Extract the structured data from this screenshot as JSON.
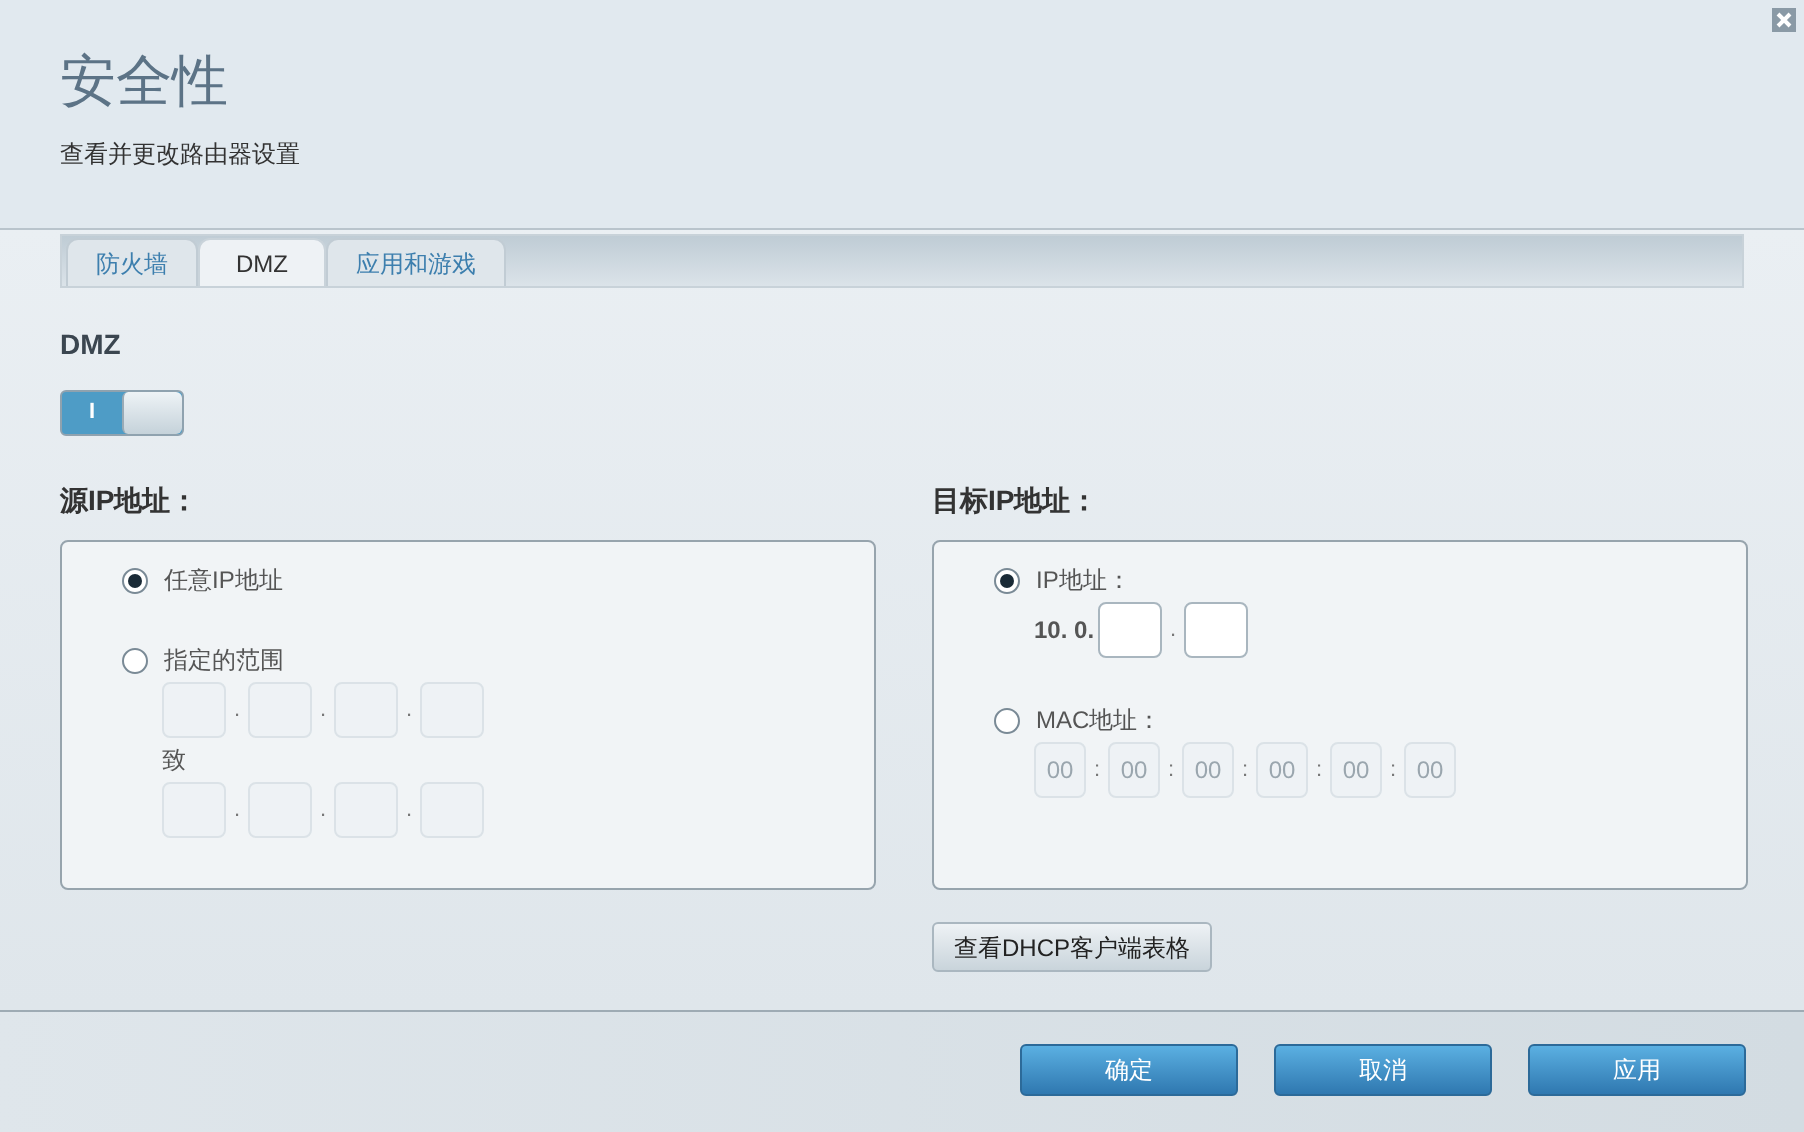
{
  "title": "安全性",
  "subtitle": "查看并更改路由器设置",
  "tabs": [
    {
      "label": "防火墙",
      "selected": false
    },
    {
      "label": "DMZ",
      "selected": true
    },
    {
      "label": "应用和游戏",
      "selected": false
    }
  ],
  "dmz": {
    "label": "DMZ",
    "on": true,
    "toggle_text": "I"
  },
  "source": {
    "heading": "源IP地址：",
    "options": [
      {
        "kind": "any",
        "label": "任意IP地址",
        "selected": true
      },
      {
        "kind": "range",
        "label": "指定的范围",
        "selected": false,
        "separator": ".",
        "range_word": "致"
      }
    ]
  },
  "destination": {
    "heading": "目标IP地址：",
    "options": [
      {
        "kind": "ip",
        "label": "IP地址：",
        "selected": true,
        "prefix": "10. 0.",
        "separator": "."
      },
      {
        "kind": "mac",
        "label": "MAC地址：",
        "selected": false,
        "separator": ":",
        "placeholders": [
          "00",
          "00",
          "00",
          "00",
          "00",
          "00"
        ]
      }
    ]
  },
  "dhcp_button": "查看DHCP客户端表格",
  "buttons": [
    "确定",
    "取消",
    "应用"
  ]
}
